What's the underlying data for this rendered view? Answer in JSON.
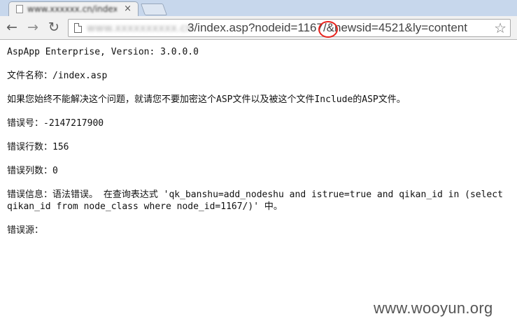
{
  "browser": {
    "tab": {
      "title": "www.xxxxxx.cn/index.asp?nodeid",
      "close_glyph": "×"
    },
    "toolbar": {
      "back_glyph": "←",
      "forward_glyph": "→",
      "reload_glyph": "↻",
      "url_host": "www.xxxxxxxxxx.cn",
      "url_path": "3/index.asp?nodeid=1167/&newsid=4521&ly=content",
      "star_glyph": "☆"
    }
  },
  "error_page": {
    "product": "AspApp Enterprise, Version: 3.0.0.0",
    "file_name": "文件名称：/index.asp",
    "advice": "如果您始终不能解决这个问题，就请您不要加密这个ASP文件以及被这个文件Include的ASP文件。",
    "error_number": "错误号：-2147217900",
    "error_line": "错误行数：156",
    "error_column": "错误列数：0",
    "error_message": "错误信息：语法错误。 在查询表达式 'qk_banshu=add_nodeshu and istrue=true and qikan_id in (select qikan_id from node_class where node_id=1167/)' 中。",
    "error_source": "错误源："
  },
  "watermark": "www.wooyun.org",
  "colors": {
    "highlight_circle": "#e8221c",
    "tab_strip": "#c7d7ec"
  }
}
